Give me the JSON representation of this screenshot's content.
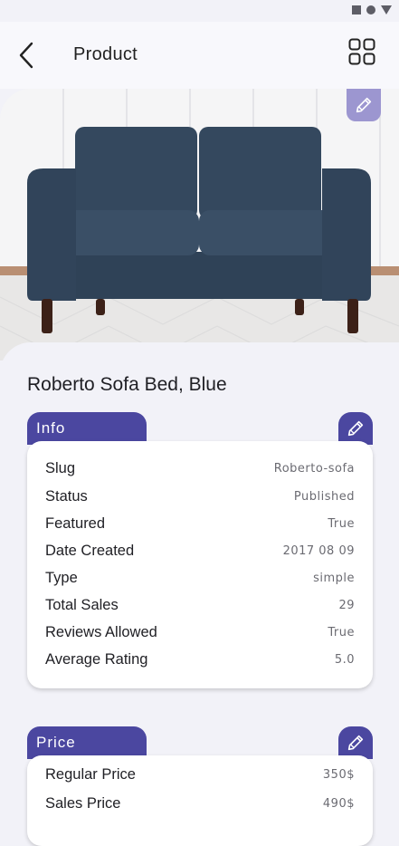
{
  "header": {
    "title": "Product"
  },
  "product": {
    "name": "Roberto Sofa Bed, Blue"
  },
  "info": {
    "label": "Info",
    "rows": [
      {
        "key": "Slug",
        "value": "Roberto-sofa"
      },
      {
        "key": "Status",
        "value": "Published"
      },
      {
        "key": "Featured",
        "value": "True"
      },
      {
        "key": "Date Created",
        "value": "2017 08 09"
      },
      {
        "key": "Type",
        "value": "simple"
      },
      {
        "key": "Total Sales",
        "value": "29"
      },
      {
        "key": "Reviews Allowed",
        "value": "True"
      },
      {
        "key": "Average Rating",
        "value": "5.0"
      }
    ]
  },
  "price": {
    "label": "Price",
    "rows": [
      {
        "key": "Regular Price",
        "value": "350$"
      },
      {
        "key": "Sales Price",
        "value": "490$"
      }
    ]
  },
  "colors": {
    "accent": "#4b47a0",
    "accent_light": "#9c96d0",
    "sofa": "#34485e"
  }
}
